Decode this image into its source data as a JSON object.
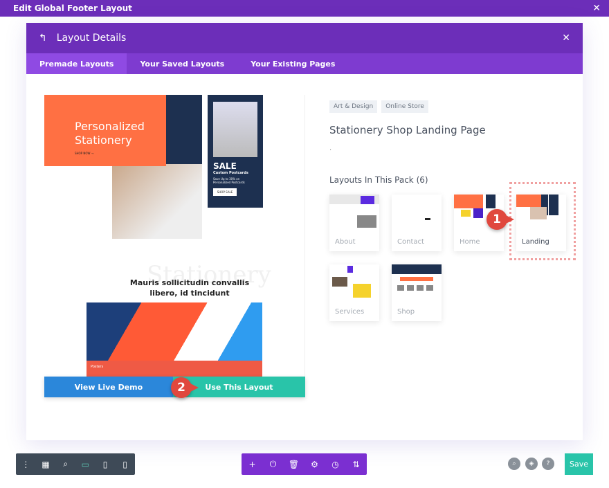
{
  "window": {
    "title": "Edit Global Footer Layout",
    "close_icon": "close-icon"
  },
  "modal": {
    "title": "Layout Details",
    "back_icon": "back-arrow-icon",
    "close_icon": "close-icon",
    "tabs": [
      {
        "label": "Premade Layouts",
        "active": true
      },
      {
        "label": "Your Saved Layouts"
      },
      {
        "label": "Your Existing Pages"
      }
    ]
  },
  "preview": {
    "hero_title_1": "Personalized",
    "hero_title_2": "Stationery",
    "hero_cta": "SHOP NOW →",
    "sale_title": "SALE",
    "sale_sub": "Custom Postcards",
    "sale_text": "Save Up to 30% on Personalized Postcards",
    "sale_btn": "SHOP SALE",
    "bg_word": "Stationery",
    "heading_1": "Mauris sollicitudin convallis",
    "heading_2": "libero, id tincidunt",
    "footer_label": "Posters",
    "view_demo": "View Live Demo",
    "use_layout": "Use This Layout"
  },
  "details": {
    "tags": [
      "Art & Design",
      "Online Store"
    ],
    "title": "Stationery Shop Landing Page",
    "description": ".",
    "pack_heading": "Layouts In This Pack (6)",
    "layouts": [
      {
        "label": "About"
      },
      {
        "label": "Contact"
      },
      {
        "label": "Home"
      },
      {
        "label": "Landing",
        "selected": true
      },
      {
        "label": "Services"
      },
      {
        "label": "Shop"
      }
    ]
  },
  "callouts": [
    "1",
    "2"
  ],
  "toolbar": {
    "save": "Save",
    "help": "?"
  },
  "colors": {
    "purple": "#6c2eb9",
    "tab_bar": "#7e3bd0",
    "blue": "#2b87da",
    "green": "#29c4a9",
    "orange": "#ff7043",
    "navy": "#1d3050",
    "badge": "#e0483e"
  }
}
